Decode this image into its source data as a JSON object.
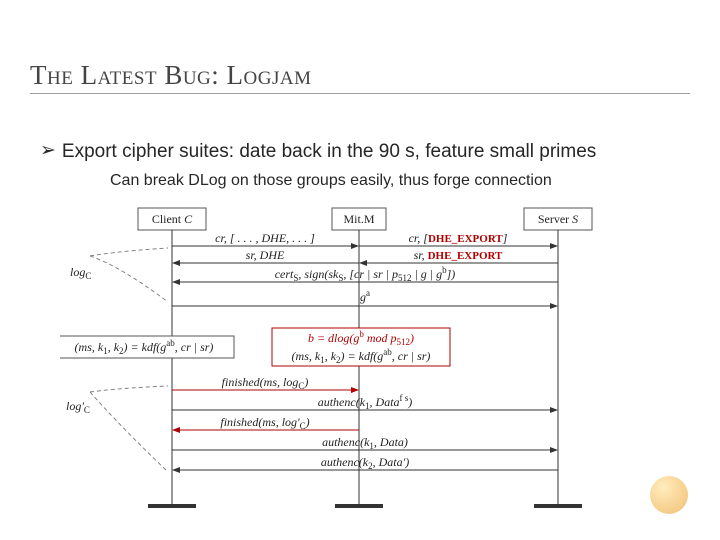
{
  "title": "The Latest Bug: Logjam",
  "bullet": "Export cipher suites: date back in the 90 s, feature small primes",
  "subbullet": "Can break DLog on those groups easily, thus forge connection",
  "diagram": {
    "actors": {
      "client": {
        "label": "Client ",
        "var": "C"
      },
      "mitm": {
        "label": "Mit.M"
      },
      "server": {
        "label": "Server ",
        "var": "S"
      }
    },
    "log_c": "log",
    "log_c_sub": "C",
    "log_c2": "log'",
    "log_c2_sub": "C",
    "m1_left": "cr, [ . . . , DHE, . . . ]",
    "m1_right_a": "cr, [",
    "m1_right_b": "DHE_EXPORT",
    "m1_right_c": "]",
    "m2_left": "sr, DHE",
    "m2_right_a": "sr, ",
    "m2_right_b": "DHE_EXPORT",
    "m3_a": "cert",
    "m3_sub": "S",
    "m3_b": ", sign(sk",
    "m3_c": ", [cr | sr | p",
    "m3_p": "512",
    "m3_d": " | g | g",
    "m3_exp": "b",
    "m3_e": "])",
    "m4": "g",
    "m4_exp": "a",
    "kdf_a": "(ms, k",
    "kdf_1": "1",
    "kdf_b": ", k",
    "kdf_2": "2",
    "kdf_c": ") = kdf(g",
    "kdf_ab": "ab",
    "kdf_d": ", cr | sr)",
    "mitm_a": "b = dlog(g",
    "mitm_b": "b",
    "mitm_c": " mod p",
    "mitm_512": "512",
    "mitm_d": ")",
    "fin_a": "finished(ms, log",
    "fin_c": "C",
    "fin_b": ")",
    "ae_a": "authenc(k",
    "ae1": "1",
    "ae_b": ", Data",
    "ae_fs": "f s",
    "ae_c": ")",
    "fin2_a": "finished(ms, log'",
    "fin2_c": "C",
    "fin2_b": ")",
    "ae2_a": "authenc(k",
    "ae2_b": ", Data)",
    "ae3_a": "authenc(k",
    "ae3_k": "2",
    "ae3_b": ", Data')"
  }
}
